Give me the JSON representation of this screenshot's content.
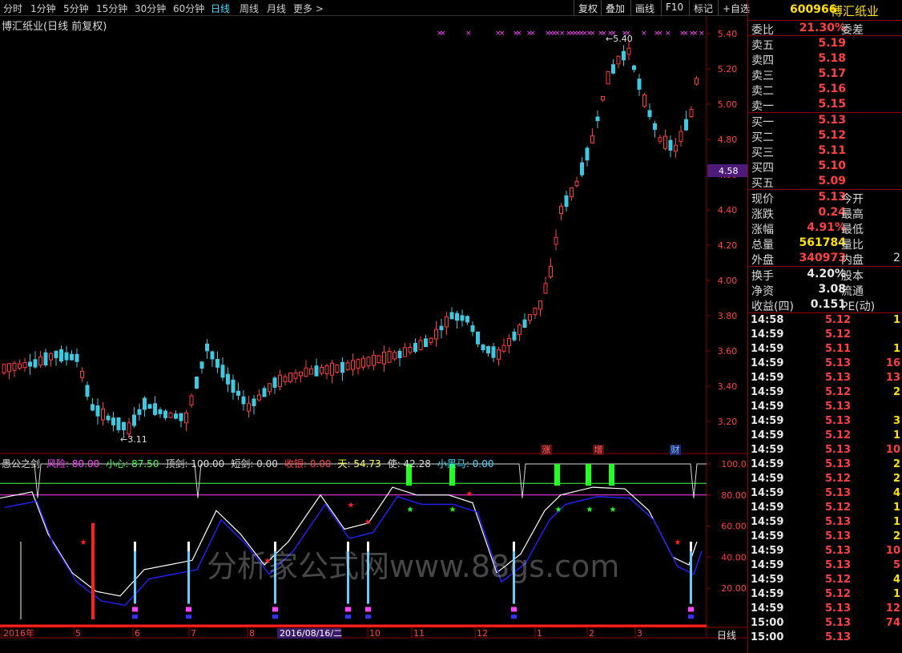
{
  "toolbar": {
    "periods": [
      "分时",
      "1分钟",
      "5分钟",
      "15分钟",
      "30分钟",
      "60分钟",
      "日线",
      "周线",
      "月线",
      "更多 >"
    ],
    "active": "日线",
    "buttons": [
      "复权",
      "叠加",
      "画线",
      "F10",
      "标记",
      "+自选"
    ]
  },
  "chart": {
    "title": "博汇纸业(日线 前复权)",
    "high_label": "←5.40",
    "low_label": "←3.11",
    "current_price_tag": "4.58",
    "price_axis": [
      "5.40",
      "5.20",
      "5.00",
      "4.80",
      "4.60",
      "4.40",
      "4.20",
      "4.00",
      "3.80",
      "3.60",
      "3.40",
      "3.20"
    ],
    "event_badges": [
      "涨",
      "增",
      "财"
    ]
  },
  "indicator": {
    "name": "愚公之剑",
    "values": [
      {
        "text": "风险: 80.00",
        "color": "#ff44ff"
      },
      {
        "text": "小心: 87.50",
        "color": "#44ff44"
      },
      {
        "text": "顶剑: 100.00",
        "color": "#d8d8d8"
      },
      {
        "text": "短剑: 0.00",
        "color": "#d8d8d8"
      },
      {
        "text": "收银: 0.00",
        "color": "#ff4040"
      },
      {
        "text": "天: 54.73",
        "color": "#ffff44"
      },
      {
        "text": "使: 42.28",
        "color": "#d8d8d8"
      },
      {
        "text": "小黑马: 0.00",
        "color": "#44ddff"
      }
    ],
    "axis": [
      "100.0",
      "80.00",
      "60.00",
      "40.00",
      "20.00"
    ],
    "watermark": "分析家公式网www.88gs.com"
  },
  "date_axis": {
    "labels": [
      "2016年",
      "5",
      "6",
      "7",
      "8",
      "10",
      "11",
      "12",
      "1",
      "2",
      "3"
    ],
    "cursor_date": "2016/08/16/二",
    "period": "日线"
  },
  "panel": {
    "code": "600966",
    "name": "博汇纸业",
    "ratio": {
      "label": "委比",
      "value": "21.30%",
      "label2": "委差"
    },
    "asks": [
      {
        "label": "卖五",
        "price": "5.19"
      },
      {
        "label": "卖四",
        "price": "5.18"
      },
      {
        "label": "卖三",
        "price": "5.17"
      },
      {
        "label": "卖二",
        "price": "5.16"
      },
      {
        "label": "卖一",
        "price": "5.15"
      }
    ],
    "bids": [
      {
        "label": "买一",
        "price": "5.13"
      },
      {
        "label": "买二",
        "price": "5.12"
      },
      {
        "label": "买三",
        "price": "5.11"
      },
      {
        "label": "买四",
        "price": "5.10"
      },
      {
        "label": "买五",
        "price": "5.09"
      }
    ],
    "quote": [
      {
        "label": "现价",
        "value": "5.13",
        "color": "red",
        "label2": "今开"
      },
      {
        "label": "涨跌",
        "value": "0.24",
        "color": "red",
        "label2": "最高"
      },
      {
        "label": "涨幅",
        "value": "4.91%",
        "color": "red",
        "label2": "最低"
      },
      {
        "label": "总量",
        "value": "561784",
        "color": "yel",
        "label2": "量比"
      },
      {
        "label": "外盘",
        "value": "340973",
        "color": "red",
        "label2": "内盘",
        "value2": "2"
      }
    ],
    "fundamentals": [
      {
        "label": "换手",
        "value": "4.20%",
        "label2": "股本"
      },
      {
        "label": "净资",
        "value": "3.08",
        "label2": "流通"
      },
      {
        "label": "收益(四)",
        "value": "0.151",
        "label2": "PE(动)"
      }
    ],
    "ticks": [
      {
        "time": "14:58",
        "price": "5.12",
        "color": "red",
        "vol": "1",
        "vcolor": "yel"
      },
      {
        "time": "14:59",
        "price": "5.12",
        "color": "red",
        "vol": "",
        "vcolor": "yel"
      },
      {
        "time": "14:59",
        "price": "5.11",
        "color": "red",
        "vol": "1",
        "vcolor": "yel"
      },
      {
        "time": "14:59",
        "price": "5.13",
        "color": "red",
        "vol": "16",
        "vcolor": "red"
      },
      {
        "time": "14:59",
        "price": "5.13",
        "color": "red",
        "vol": "13",
        "vcolor": "red"
      },
      {
        "time": "14:59",
        "price": "5.12",
        "color": "red",
        "vol": "2",
        "vcolor": "yel"
      },
      {
        "time": "14:59",
        "price": "5.13",
        "color": "red",
        "vol": "",
        "vcolor": "yel"
      },
      {
        "time": "14:59",
        "price": "5.13",
        "color": "red",
        "vol": "3",
        "vcolor": "yel"
      },
      {
        "time": "14:59",
        "price": "5.12",
        "color": "red",
        "vol": "1",
        "vcolor": "yel"
      },
      {
        "time": "14:59",
        "price": "5.13",
        "color": "red",
        "vol": "10",
        "vcolor": "red"
      },
      {
        "time": "14:59",
        "price": "5.13",
        "color": "red",
        "vol": "2",
        "vcolor": "yel"
      },
      {
        "time": "14:59",
        "price": "5.12",
        "color": "red",
        "vol": "2",
        "vcolor": "yel"
      },
      {
        "time": "14:59",
        "price": "5.13",
        "color": "red",
        "vol": "4",
        "vcolor": "yel"
      },
      {
        "time": "14:59",
        "price": "5.12",
        "color": "red",
        "vol": "1",
        "vcolor": "yel"
      },
      {
        "time": "14:59",
        "price": "5.13",
        "color": "red",
        "vol": "1",
        "vcolor": "yel"
      },
      {
        "time": "14:59",
        "price": "5.13",
        "color": "red",
        "vol": "2",
        "vcolor": "yel"
      },
      {
        "time": "14:59",
        "price": "5.13",
        "color": "red",
        "vol": "10",
        "vcolor": "red"
      },
      {
        "time": "14:59",
        "price": "5.13",
        "color": "red",
        "vol": "5",
        "vcolor": "red"
      },
      {
        "time": "14:59",
        "price": "5.12",
        "color": "red",
        "vol": "4",
        "vcolor": "yel"
      },
      {
        "time": "14:59",
        "price": "5.12",
        "color": "red",
        "vol": "1",
        "vcolor": "yel"
      },
      {
        "time": "14:59",
        "price": "5.13",
        "color": "red",
        "vol": "12",
        "vcolor": "red"
      },
      {
        "time": "15:00",
        "price": "5.13",
        "color": "red",
        "vol": "74",
        "vcolor": "red"
      },
      {
        "time": "15:00",
        "price": "5.13",
        "color": "red",
        "vol": "",
        "vcolor": "red"
      }
    ]
  },
  "colors": {
    "up": "#ff3b3b",
    "down": "#40c8e0",
    "panel_border": "#8b0000",
    "axis": "#8b0000",
    "signal_green": "#22ff22",
    "risk_line": "#ff44ff",
    "caution_line": "#44ff44"
  }
}
